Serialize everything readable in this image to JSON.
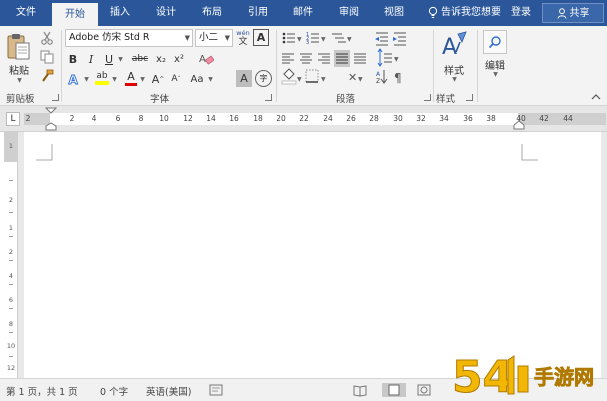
{
  "menu": {
    "tabs": [
      {
        "label": "文件",
        "active": false
      },
      {
        "label": "开始",
        "active": true
      },
      {
        "label": "插入",
        "active": false
      },
      {
        "label": "设计",
        "active": false
      },
      {
        "label": "布局",
        "active": false
      },
      {
        "label": "引用",
        "active": false
      },
      {
        "label": "邮件",
        "active": false
      },
      {
        "label": "审阅",
        "active": false
      },
      {
        "label": "视图",
        "active": false
      }
    ],
    "tell_me": "告诉我您想要",
    "login": "登录",
    "share": "共享"
  },
  "ribbon": {
    "clipboard": {
      "group_label": "剪贴板",
      "paste_label": "粘贴"
    },
    "font": {
      "group_label": "字体",
      "font_name": "Adobe 仿宋 Std R",
      "font_size": "小二",
      "phonetic_top": "wén",
      "phonetic_bottom": "文",
      "char_border": "A",
      "bold": "B",
      "italic": "I",
      "underline": "U",
      "strikethrough": "abc",
      "subscript": "x₂",
      "superscript": "x²",
      "highlight_letters": "ab",
      "grow_font": "A",
      "shrink_font": "A",
      "change_case": "Aa",
      "char_shading": "A",
      "enclose": "字"
    },
    "paragraph": {
      "group_label": "段落"
    },
    "styles": {
      "group_label": "样式",
      "styles_label": "样式"
    },
    "editing": {
      "editing_label": "编辑"
    }
  },
  "ruler": {
    "selector": "L",
    "numbers": [
      "2",
      "2",
      "4",
      "6",
      "8",
      "10",
      "12",
      "14",
      "16",
      "18",
      "20",
      "22",
      "24",
      "26",
      "28",
      "30",
      "32",
      "34",
      "36",
      "38",
      "40",
      "42",
      "44"
    ]
  },
  "vruler": {
    "numbers": [
      "1",
      "2",
      "1",
      "2",
      "4",
      "6",
      "8",
      "10",
      "12"
    ]
  },
  "status": {
    "page": "第 1 页，共 1 页",
    "words": "0 个字",
    "language": "英语(美国)"
  },
  "colors": {
    "accent": "#2b579a",
    "highlight_yellow": "#ffff00",
    "font_red": "#e00000"
  },
  "watermark_text": "54 手游网"
}
